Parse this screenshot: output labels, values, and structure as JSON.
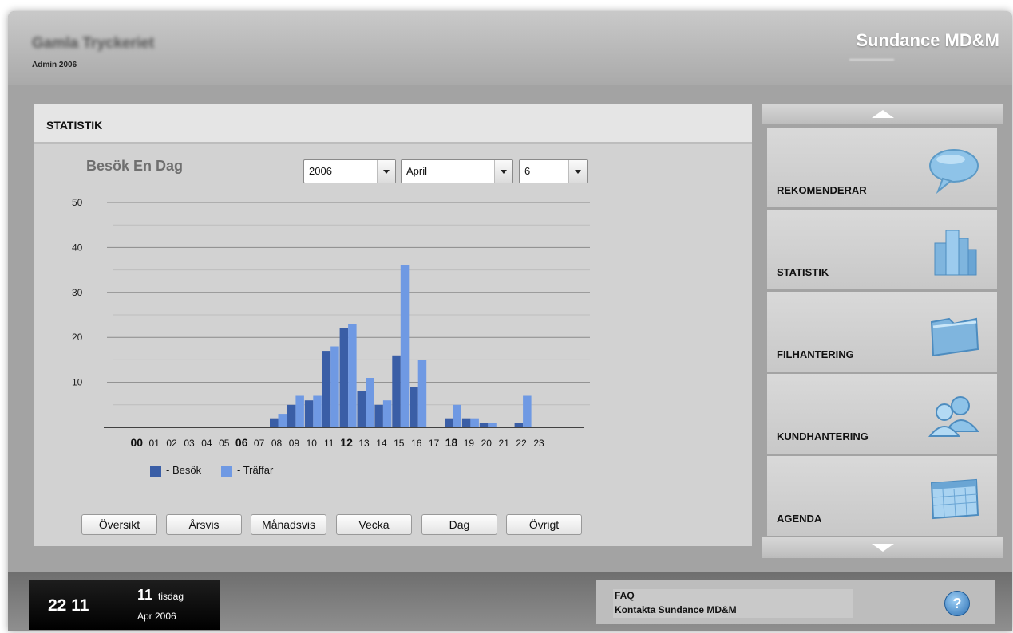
{
  "header": {
    "company_name": "Gamla Tryckeriet",
    "subtitle": "Admin 2006",
    "brand": "Sundance MD&M"
  },
  "panel": {
    "title": "STATISTIK",
    "chart_heading": "Besök En Dag",
    "selects": {
      "year": "2006",
      "month": "April",
      "day": "6"
    }
  },
  "chart_data": {
    "type": "bar",
    "title": "Besök En Dag",
    "xlabel": "",
    "ylabel": "",
    "ylim": [
      0,
      50
    ],
    "yticks": [
      10,
      20,
      30,
      40,
      50
    ],
    "grid": true,
    "categories": [
      "00",
      "01",
      "02",
      "03",
      "04",
      "05",
      "06",
      "07",
      "08",
      "09",
      "10",
      "11",
      "12",
      "13",
      "14",
      "15",
      "16",
      "17",
      "18",
      "19",
      "20",
      "21",
      "22",
      "23"
    ],
    "bold_categories": [
      "00",
      "06",
      "12",
      "18"
    ],
    "series": [
      {
        "name": "Besök",
        "color": "#3a5ea6",
        "values": [
          0,
          0,
          0,
          0,
          0,
          0,
          0,
          0,
          2,
          5,
          6,
          17,
          22,
          8,
          5,
          16,
          9,
          0,
          2,
          2,
          1,
          0,
          1,
          0
        ]
      },
      {
        "name": "Träffar",
        "color": "#6f99e3",
        "values": [
          0,
          0,
          0,
          0,
          0,
          0,
          0,
          0,
          3,
          7,
          7,
          18,
          23,
          11,
          6,
          36,
          15,
          0,
          5,
          2,
          1,
          0,
          7,
          0
        ]
      }
    ],
    "legend": "bottom-left"
  },
  "legend": [
    {
      "label": "- Besök"
    },
    {
      "label": "- Träffar"
    }
  ],
  "buttons": [
    "Översikt",
    "Årsvis",
    "Månadsvis",
    "Vecka",
    "Dag",
    "Övrigt"
  ],
  "sidebar": {
    "items": [
      {
        "label": "REKOMENDERAR",
        "icon": "speech-bubble-icon"
      },
      {
        "label": "STATISTIK",
        "icon": "bar-chart-icon"
      },
      {
        "label": "FILHANTERING",
        "icon": "folder-icon"
      },
      {
        "label": "KUNDHANTERING",
        "icon": "users-icon"
      },
      {
        "label": "AGENDA",
        "icon": "calendar-icon"
      }
    ]
  },
  "footer": {
    "time": "22 11",
    "day": "11",
    "weekday": "tisdag",
    "month_year": "Apr  2006",
    "faq": "FAQ",
    "contact": "Kontakta Sundance MD&M",
    "help_glyph": "?"
  },
  "colors": {
    "besok": "#3a5ea6",
    "traffar": "#6f99e3",
    "icon_blue": "#7fb5de"
  }
}
